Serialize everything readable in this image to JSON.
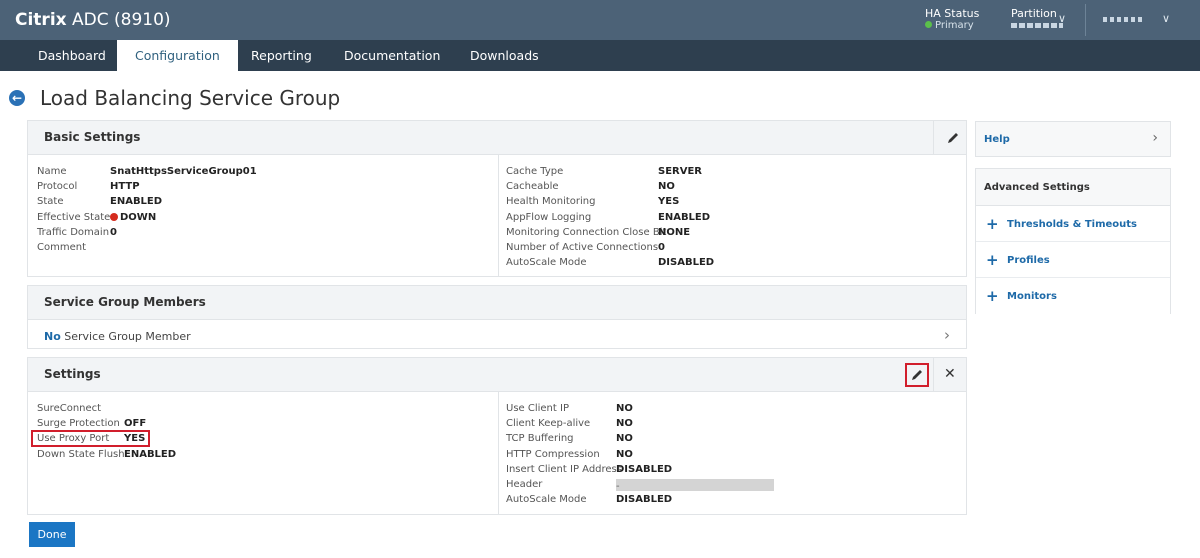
{
  "header": {
    "brand_bold": "Citrix",
    "brand_rest": "ADC (8910)",
    "ha_status_label": "HA Status",
    "ha_status_value": "Primary",
    "partition_label": "Partition"
  },
  "nav": {
    "tabs": [
      {
        "label": "Dashboard",
        "active": false
      },
      {
        "label": "Configuration",
        "active": true
      },
      {
        "label": "Reporting",
        "active": false
      },
      {
        "label": "Documentation",
        "active": false
      },
      {
        "label": "Downloads",
        "active": false
      }
    ]
  },
  "page": {
    "title": "Load Balancing Service Group"
  },
  "basic": {
    "title": "Basic Settings",
    "left": [
      {
        "k": "Name",
        "v": "SnatHttpsServiceGroup01"
      },
      {
        "k": "Protocol",
        "v": "HTTP"
      },
      {
        "k": "State",
        "v": "ENABLED"
      },
      {
        "k": "Effective State",
        "v": "DOWN"
      },
      {
        "k": "Traffic Domain",
        "v": "0"
      },
      {
        "k": "Comment",
        "v": ""
      }
    ],
    "right": [
      {
        "k": "Cache Type",
        "v": "SERVER"
      },
      {
        "k": "Cacheable",
        "v": "NO"
      },
      {
        "k": "Health Monitoring",
        "v": "YES"
      },
      {
        "k": "AppFlow Logging",
        "v": "ENABLED"
      },
      {
        "k": "Monitoring Connection Close Bit",
        "v": "NONE"
      },
      {
        "k": "Number of Active Connections",
        "v": "0"
      },
      {
        "k": "AutoScale Mode",
        "v": "DISABLED"
      }
    ]
  },
  "members": {
    "title": "Service Group Members",
    "count_word": "No",
    "text": "Service Group Member"
  },
  "settings": {
    "title": "Settings",
    "left": [
      {
        "k": "SureConnect",
        "v": ""
      },
      {
        "k": "Surge Protection",
        "v": "OFF"
      },
      {
        "k": "Use Proxy Port",
        "v": "YES"
      },
      {
        "k": "Down State Flush",
        "v": "ENABLED"
      }
    ],
    "right": [
      {
        "k": "Use Client IP",
        "v": "NO"
      },
      {
        "k": "Client Keep-alive",
        "v": "NO"
      },
      {
        "k": "TCP Buffering",
        "v": "NO"
      },
      {
        "k": "HTTP Compression",
        "v": "NO"
      },
      {
        "k": "Insert Client IP Address",
        "v": "DISABLED"
      },
      {
        "k": "Header",
        "v": "-"
      },
      {
        "k": "AutoScale Mode",
        "v": "DISABLED"
      }
    ]
  },
  "done_label": "Done",
  "side": {
    "help": "Help",
    "advanced_title": "Advanced Settings",
    "items": [
      "Thresholds & Timeouts",
      "Profiles",
      "Monitors"
    ]
  },
  "colors": {
    "header_bg": "#4c6277",
    "nav_bg": "#2e3f4f",
    "accent": "#1b76c4",
    "highlight": "#d11e2c",
    "down": "#d52b1e",
    "primary_ok": "#5bc04a"
  }
}
